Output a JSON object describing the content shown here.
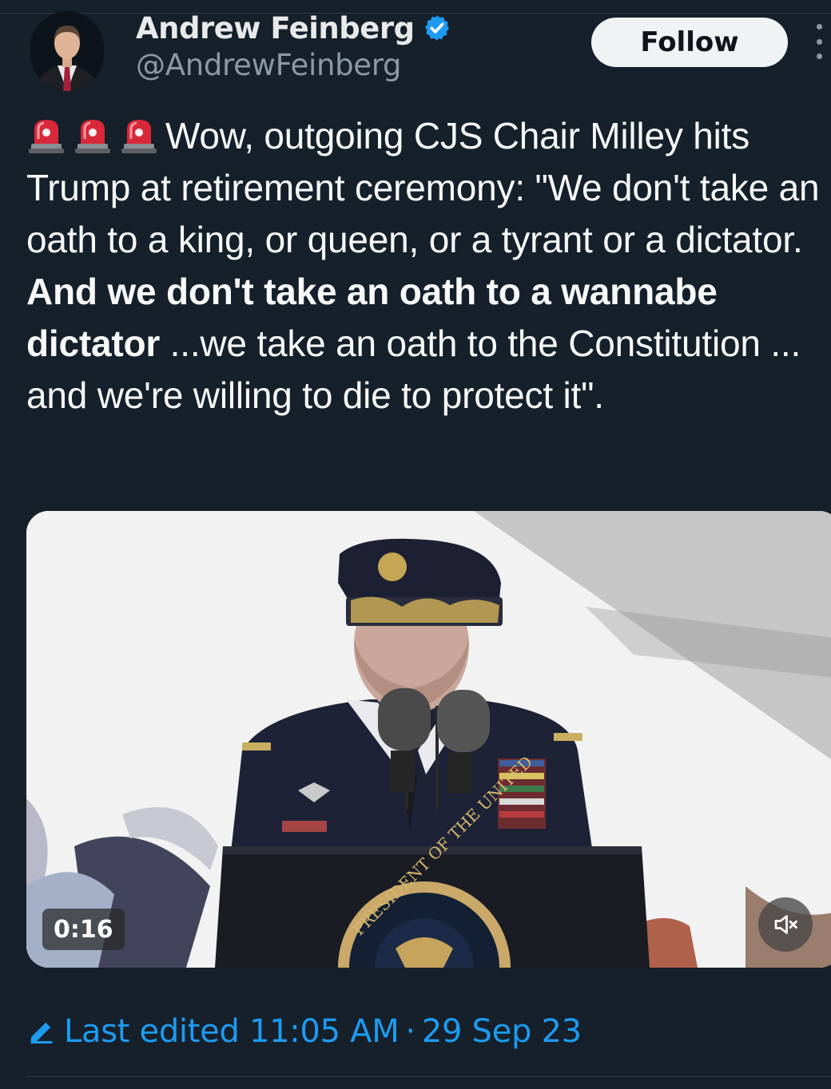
{
  "author": {
    "display_name": "Andrew Feinberg",
    "handle": "@AndrewFeinberg",
    "verified": true,
    "verified_color": "#1d9bf0"
  },
  "actions": {
    "follow_label": "Follow",
    "more_icon": "more-vertical-icon"
  },
  "tweet": {
    "emoji": "siren-emoji",
    "text_part1": "Wow, outgoing CJS Chair Milley hits Trump at retirement ceremony: \"We don't take an oath to a king, or queen, or a tyrant or a dictator. ",
    "text_bold": "And we don't take an oath to a wannabe dictator",
    "text_part2": " ...we take an oath to the Constitution ... and we're willing to die to protect it\"."
  },
  "media": {
    "type": "video",
    "duration": "0:16",
    "mute_icon": "volume-muted-icon",
    "seal_text": "PRESIDENT OF THE UNITED"
  },
  "footer": {
    "edit_icon": "pencil-icon",
    "edited_label": "Last edited 11:05 AM",
    "separator": "·",
    "date": "29 Sep 23"
  },
  "colors": {
    "background": "#15202b",
    "text": "#f7f9f9",
    "secondary": "#8b98a5",
    "accent": "#1d9bf0",
    "follow_bg": "#eff3f4"
  }
}
